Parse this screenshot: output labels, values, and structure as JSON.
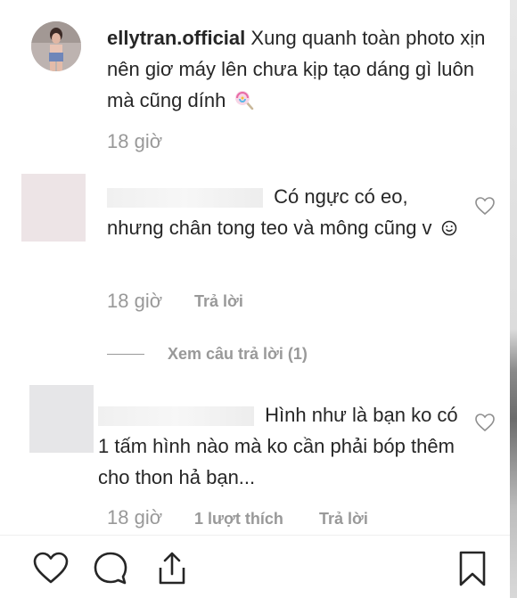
{
  "post": {
    "username": "ellytran.official",
    "caption": "Xung quanh toàn photo xịn nên giơ máy lên chưa kịp tạo dáng gì luôn mà cũng dính",
    "caption_emoji": "lollipop-icon",
    "time": "18 giờ"
  },
  "comments": [
    {
      "text": "Có ngực có eo, nhưng chân tong teo và mông cũng v",
      "emoji": "smiley-icon",
      "time": "18 giờ",
      "reply_label": "Trả lời",
      "view_replies": "Xem câu trả lời (1)"
    },
    {
      "text_tail": "Hình như là bạn ko có 1 tấm hình nào mà ko cần phải bóp thêm cho thon hả bạn...",
      "time": "18 giờ",
      "likes_label": "1 lượt thích",
      "reply_label": "Trả lời"
    }
  ],
  "colors": {
    "text": "#262626",
    "muted": "#999999",
    "border": "#efefef"
  },
  "action_bar": {
    "icons": [
      "heart-icon",
      "comment-icon",
      "share-icon",
      "bookmark-icon"
    ]
  }
}
